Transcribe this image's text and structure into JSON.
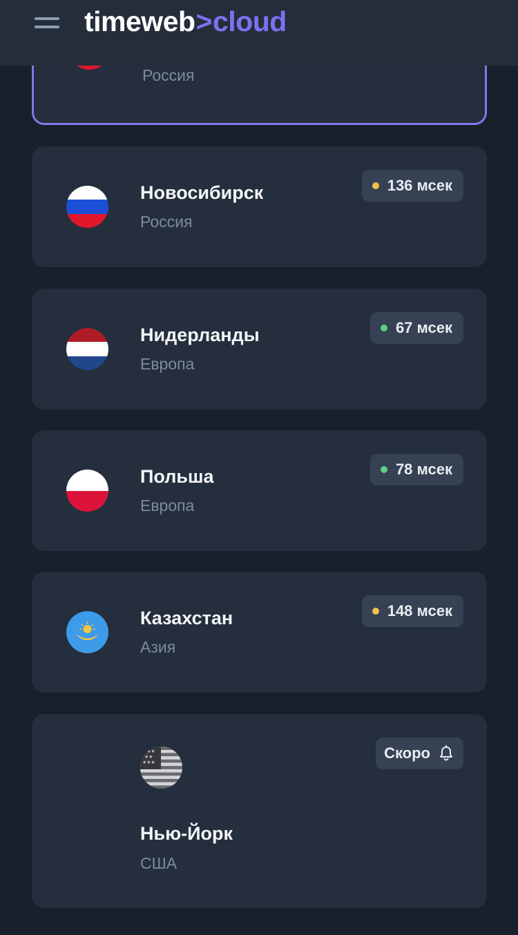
{
  "header": {
    "brand": "timeweb",
    "separator": ">",
    "product": "cloud",
    "menu_icon": "hamburger-menu-icon"
  },
  "colors": {
    "accent": "#7a72f0",
    "latency_ok": "#5fd08a",
    "latency_warn": "#f1c24a",
    "card_bg": "#242e3d",
    "page_bg": "#18202b"
  },
  "locations": [
    {
      "name": "",
      "region": "Россия",
      "flag": "russia-flag-icon",
      "selected": true
    },
    {
      "name": "Новосибирск",
      "region": "Россия",
      "flag": "russia-flag-icon",
      "latency": "136 мсек",
      "status": "warn"
    },
    {
      "name": "Нидерланды",
      "region": "Европа",
      "flag": "netherlands-flag-icon",
      "latency": "67 мсек",
      "status": "ok"
    },
    {
      "name": "Польша",
      "region": "Европа",
      "flag": "poland-flag-icon",
      "latency": "78 мсек",
      "status": "ok"
    },
    {
      "name": "Казахстан",
      "region": "Азия",
      "flag": "kazakhstan-flag-icon",
      "latency": "148 мсек",
      "status": "warn"
    },
    {
      "name": "Нью-Йорк",
      "region": "США",
      "flag": "usa-flag-icon",
      "badge": "Скоро",
      "badge_icon": "bell-icon"
    }
  ]
}
